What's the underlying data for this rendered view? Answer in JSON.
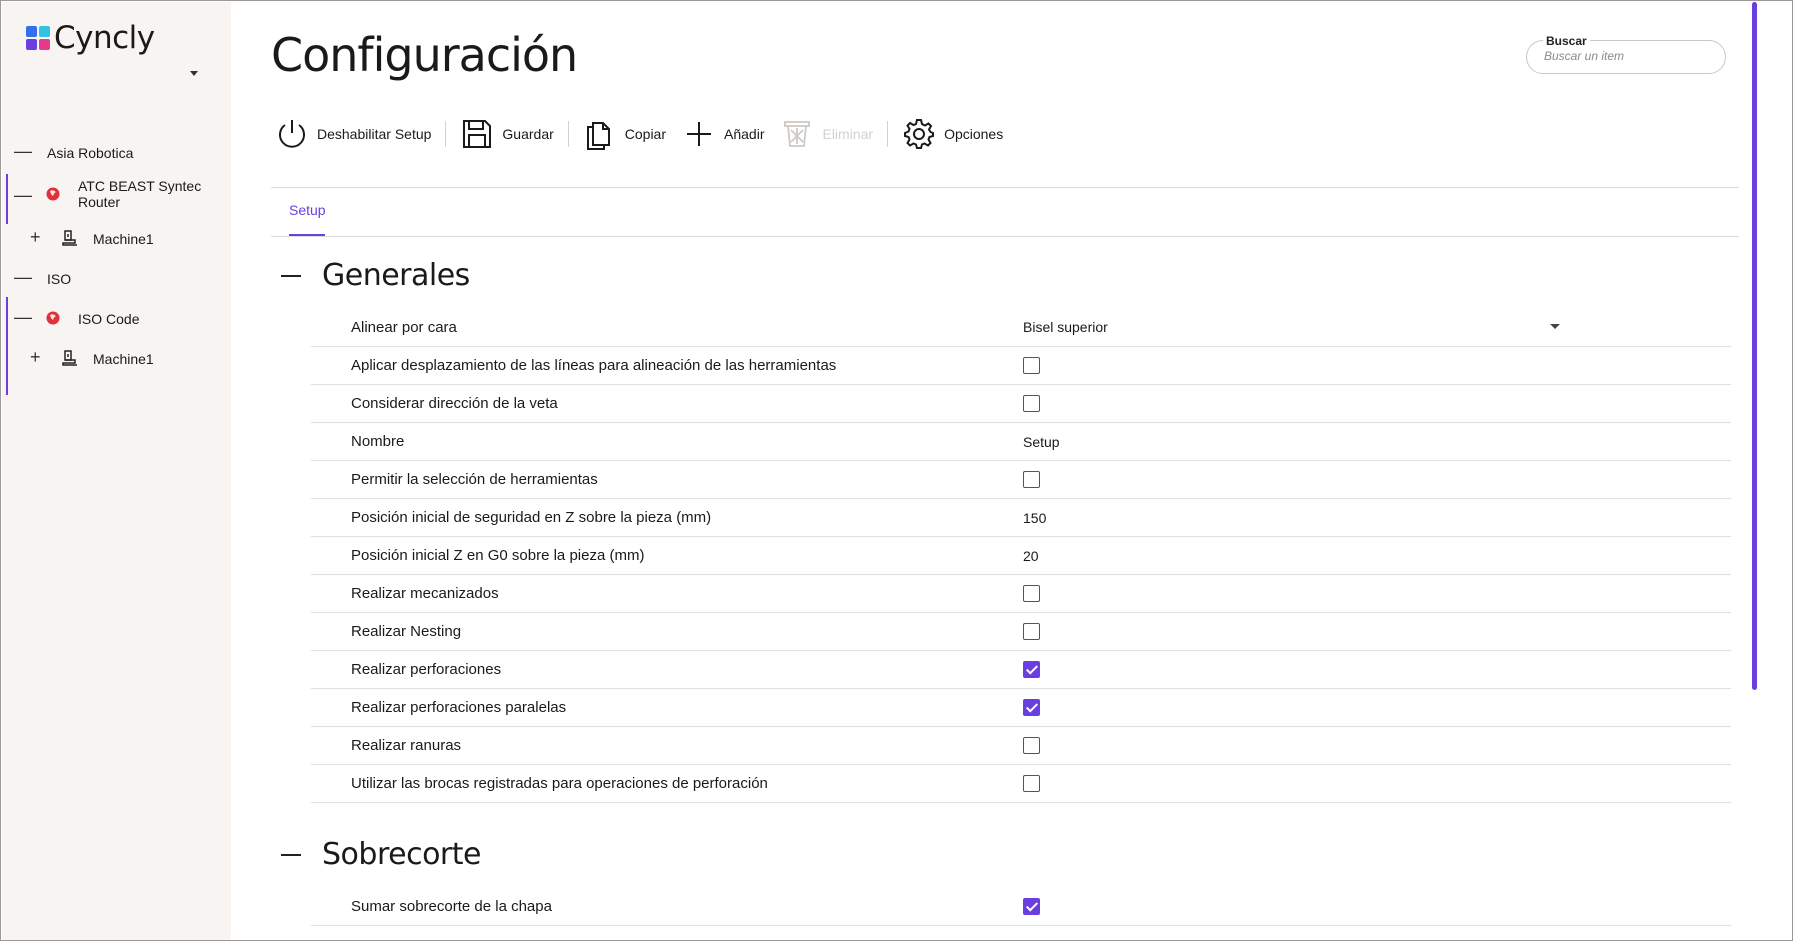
{
  "brand": {
    "name": "Cyncly"
  },
  "sidebar": {
    "items": [
      {
        "label": "Asia Robotica",
        "toggle": "—"
      },
      {
        "label": "ATC BEAST Syntec Router",
        "toggle": "—",
        "icon": "brand-circle-icon"
      },
      {
        "label": "Machine1",
        "toggle": "+",
        "icon": "machine-icon"
      },
      {
        "label": "ISO",
        "toggle": "—"
      },
      {
        "label": "ISO Code",
        "toggle": "—",
        "icon": "brand-circle-icon"
      },
      {
        "label": "Machine1",
        "toggle": "+",
        "icon": "machine-icon"
      }
    ]
  },
  "header": {
    "title": "Configuración",
    "search": {
      "label": "Buscar",
      "placeholder": "Buscar un item"
    }
  },
  "toolbar": {
    "disable_setup": "Deshabilitar Setup",
    "save": "Guardar",
    "copy": "Copiar",
    "add": "Añadir",
    "delete": "Eliminar",
    "options": "Opciones"
  },
  "tabs": [
    {
      "label": "Setup",
      "active": true
    }
  ],
  "sections": [
    {
      "title": "Generales",
      "rows": [
        {
          "label": "Alinear por cara",
          "type": "select",
          "value": "Bisel superior"
        },
        {
          "label": "Aplicar desplazamiento de las líneas para alineación de las herramientas",
          "type": "checkbox",
          "checked": false
        },
        {
          "label": "Considerar dirección de la veta",
          "type": "checkbox",
          "checked": false
        },
        {
          "label": "Nombre",
          "type": "text",
          "value": "Setup"
        },
        {
          "label": "Permitir la selección de herramientas",
          "type": "checkbox",
          "checked": false
        },
        {
          "label": "Posición inicial de seguridad en Z sobre la pieza (mm)",
          "type": "text",
          "value": "150"
        },
        {
          "label": "Posición inicial Z en G0 sobre la pieza (mm)",
          "type": "text",
          "value": "20"
        },
        {
          "label": "Realizar mecanizados",
          "type": "checkbox",
          "checked": false
        },
        {
          "label": "Realizar Nesting",
          "type": "checkbox",
          "checked": false
        },
        {
          "label": "Realizar perforaciones",
          "type": "checkbox",
          "checked": true
        },
        {
          "label": "Realizar perforaciones paralelas",
          "type": "checkbox",
          "checked": true
        },
        {
          "label": "Realizar ranuras",
          "type": "checkbox",
          "checked": false
        },
        {
          "label": "Utilizar las brocas registradas para operaciones de perforación",
          "type": "checkbox",
          "checked": false
        }
      ]
    },
    {
      "title": "Sobrecorte",
      "rows": [
        {
          "label": "Sumar sobrecorte de la chapa",
          "type": "checkbox",
          "checked": true
        }
      ]
    }
  ],
  "colors": {
    "accent": "#6a3fe0",
    "sidebar_bg": "#f8f4f1",
    "brand_red": "#e0303a"
  }
}
